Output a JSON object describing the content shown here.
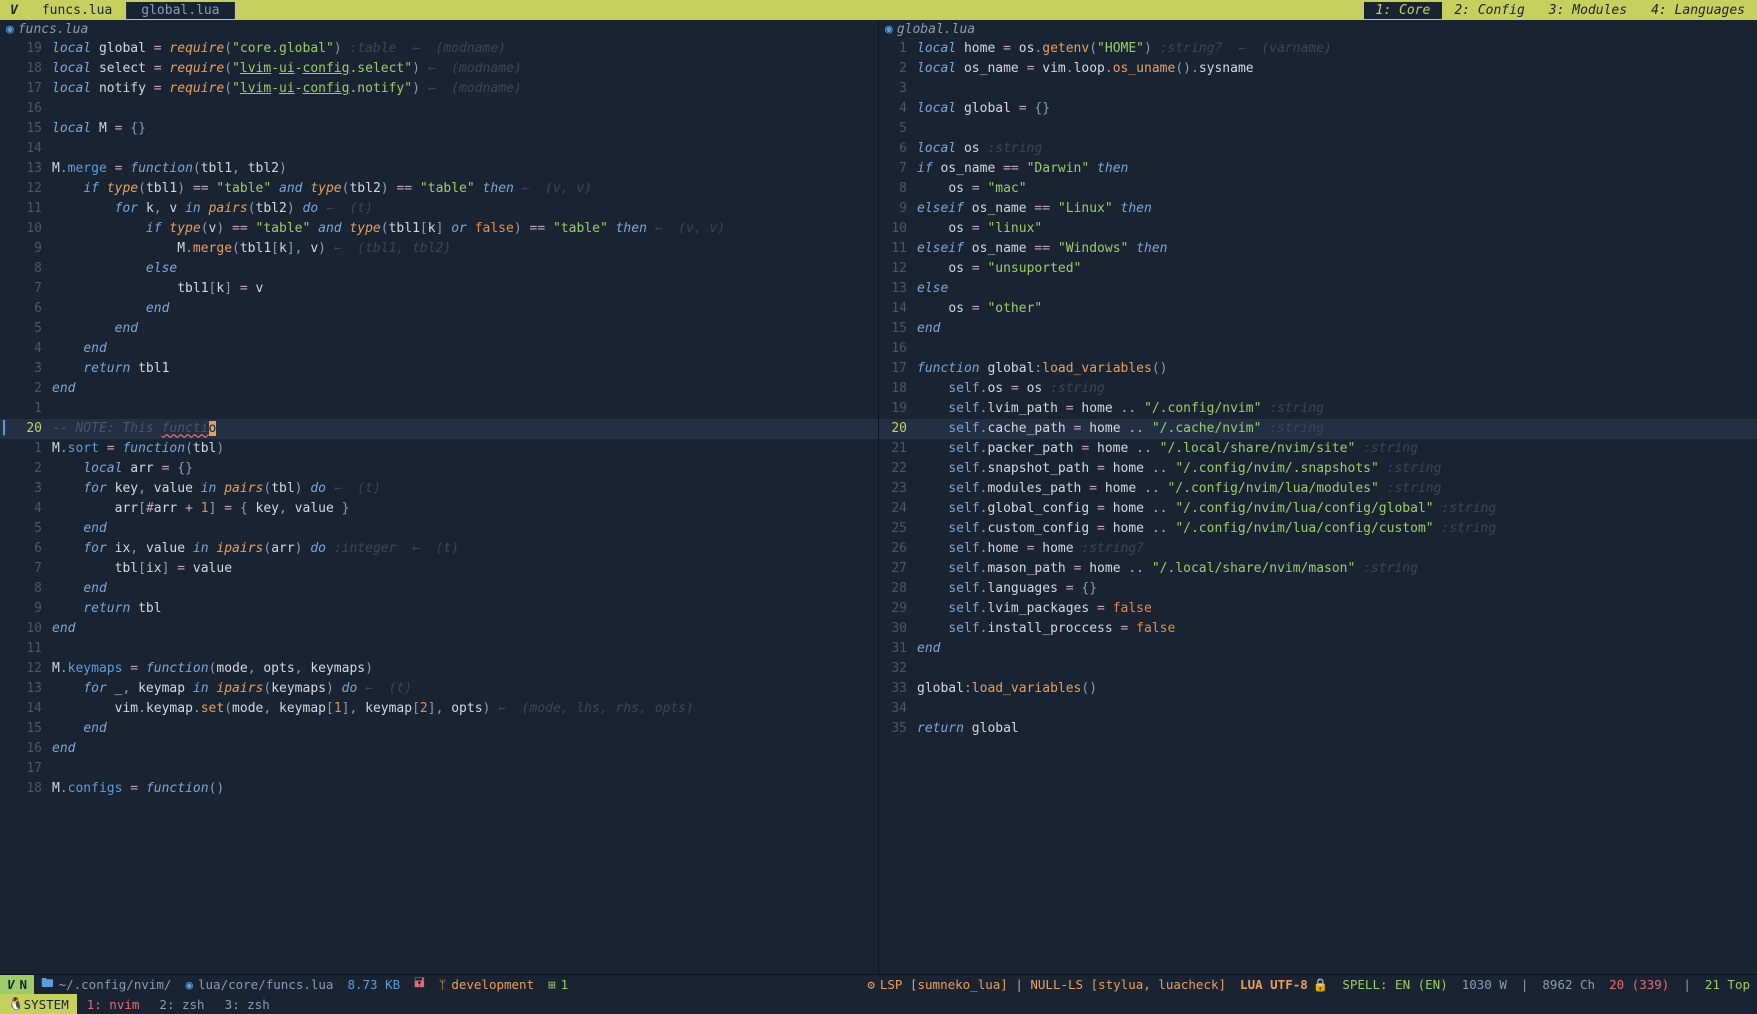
{
  "tabbar": {
    "logo": "V",
    "tabs": [
      {
        "label": "funcs.lua",
        "active": true
      },
      {
        "label": "global.lua",
        "active": false
      }
    ],
    "workspaces": [
      {
        "label": "1: Core",
        "active": true
      },
      {
        "label": "2: Config",
        "active": false
      },
      {
        "label": "3: Modules",
        "active": false
      },
      {
        "label": "4: Languages",
        "active": false
      }
    ]
  },
  "panes": {
    "left": {
      "title": "funcs.lua",
      "lines": [
        {
          "n": "19",
          "m": "",
          "h": "<span class='kw'>local</span> <span class='var'>global</span> <span class='op'>=</span> <span class='fn'>require</span><span class='paren'>(</span><span class='str'>\"core.global\"</span><span class='paren'>)</span> <span class='type'>:table</span>  <span class='hint'>←  (modname)</span>"
        },
        {
          "n": "18",
          "m": "",
          "h": "<span class='kw'>local</span> <span class='var'>select</span> <span class='op'>=</span> <span class='fn'>require</span><span class='paren'>(</span><span class='str'>\"</span><span class='strund'>lvim</span><span class='str'>-</span><span class='strund'>ui</span><span class='str'>-</span><span class='strund'>config</span><span class='str'>.select\"</span><span class='paren'>)</span> <span class='hint'>←  (modname)</span>"
        },
        {
          "n": "17",
          "m": "",
          "h": "<span class='kw'>local</span> <span class='var'>notify</span> <span class='op'>=</span> <span class='fn'>require</span><span class='paren'>(</span><span class='str'>\"</span><span class='strund'>lvim</span><span class='str'>-</span><span class='strund'>ui</span><span class='str'>-</span><span class='strund'>config</span><span class='str'>.notify\"</span><span class='paren'>)</span> <span class='hint'>←  (modname)</span>"
        },
        {
          "n": "16",
          "m": "",
          "h": ""
        },
        {
          "n": "15",
          "m": "",
          "h": "<span class='kw'>local</span> <span class='var'>M</span> <span class='op'>=</span> <span class='paren'>{}</span>"
        },
        {
          "n": "14",
          "m": "",
          "h": ""
        },
        {
          "n": "13",
          "m": "",
          "h": "<span class='var'>M</span>.<span class='field'>merge</span> <span class='op'>=</span> <span class='kw'>function</span><span class='paren'>(</span><span class='var'>tbl1</span>, <span class='var'>tbl2</span><span class='paren'>)</span>"
        },
        {
          "n": "12",
          "m": "",
          "h": "    <span class='kw'>if</span> <span class='fn'>type</span><span class='paren'>(</span><span class='var'>tbl1</span><span class='paren'>)</span> <span class='op'>==</span> <span class='str'>\"table\"</span> <span class='kw'>and</span> <span class='fn'>type</span><span class='paren'>(</span><span class='var'>tbl2</span><span class='paren'>)</span> <span class='op'>==</span> <span class='str'>\"table\"</span> <span class='kw'>then</span> <span class='hint'>←  (v, v)</span>"
        },
        {
          "n": "11",
          "m": "",
          "h": "        <span class='kw'>for</span> <span class='var'>k</span>, <span class='var'>v</span> <span class='kw'>in</span> <span class='fn'>pairs</span><span class='paren'>(</span><span class='var'>tbl2</span><span class='paren'>)</span> <span class='kw'>do</span> <span class='hint'>←  (t)</span>"
        },
        {
          "n": "10",
          "m": "",
          "h": "            <span class='kw'>if</span> <span class='fn'>type</span><span class='paren'>(</span><span class='var'>v</span><span class='paren'>)</span> <span class='op'>==</span> <span class='str'>\"table\"</span> <span class='kw'>and</span> <span class='fn'>type</span><span class='paren'>(</span><span class='var'>tbl1</span><span class='paren'>[</span><span class='var'>k</span><span class='paren'>]</span> <span class='kw'>or</span> <span class='bool'>false</span><span class='paren'>)</span> <span class='op'>==</span> <span class='str'>\"table\"</span> <span class='kw'>then</span> <span class='hint'>←  (v, v)</span>"
        },
        {
          "n": "9",
          "m": "",
          "h": "                <span class='var'>M</span>.<span class='call'>merge</span><span class='paren'>(</span><span class='var'>tbl1</span><span class='paren'>[</span><span class='var'>k</span><span class='paren'>]</span>, <span class='var'>v</span><span class='paren'>)</span> <span class='hint'>←  (tbl1, tbl2)</span>"
        },
        {
          "n": "8",
          "m": "",
          "h": "            <span class='kw'>else</span>"
        },
        {
          "n": "7",
          "m": "",
          "h": "                <span class='var'>tbl1</span><span class='paren'>[</span><span class='var'>k</span><span class='paren'>]</span> <span class='op'>=</span> <span class='var'>v</span>"
        },
        {
          "n": "6",
          "m": "",
          "h": "            <span class='kw'>end</span>"
        },
        {
          "n": "5",
          "m": "",
          "h": "        <span class='kw'>end</span>"
        },
        {
          "n": "4",
          "m": "",
          "h": "    <span class='kw'>end</span>"
        },
        {
          "n": "3",
          "m": "",
          "h": "    <span class='kw'>return</span> <span class='var'>tbl1</span>"
        },
        {
          "n": "2",
          "m": "",
          "h": "<span class='kw'>end</span>"
        },
        {
          "n": "1",
          "m": "",
          "h": ""
        },
        {
          "n": "20",
          "m": "▎",
          "cur": true,
          "h": "<span class='cm'>-- NOTE: This </span><span class='cm' style='text-decoration:underline wavy #e06c75'>functi</span><span class='cursor'>o</span>"
        },
        {
          "n": "1",
          "m": "",
          "h": "<span class='var'>M</span>.<span class='field'>sort</span> <span class='op'>=</span> <span class='kw'>function</span><span class='paren'>(</span><span class='var'>tbl</span><span class='paren'>)</span>"
        },
        {
          "n": "2",
          "m": "",
          "h": "    <span class='kw'>local</span> <span class='var'>arr</span> <span class='op'>=</span> <span class='paren'>{}</span>"
        },
        {
          "n": "3",
          "m": "",
          "h": "    <span class='kw'>for</span> <span class='var'>key</span>, <span class='var'>value</span> <span class='kw'>in</span> <span class='fn'>pairs</span><span class='paren'>(</span><span class='var'>tbl</span><span class='paren'>)</span> <span class='kw'>do</span> <span class='hint'>←  (t)</span>"
        },
        {
          "n": "4",
          "m": "",
          "h": "        <span class='var'>arr</span><span class='paren'>[</span><span class='op'>#</span><span class='var'>arr</span> <span class='op'>+</span> <span class='num'>1</span><span class='paren'>]</span> <span class='op'>=</span> <span class='paren'>{</span> <span class='var'>key</span>, <span class='var'>value</span> <span class='paren'>}</span>"
        },
        {
          "n": "5",
          "m": "",
          "h": "    <span class='kw'>end</span>"
        },
        {
          "n": "6",
          "m": "",
          "h": "    <span class='kw'>for</span> <span class='var'>ix</span>, <span class='var'>value</span> <span class='kw'>in</span> <span class='fn'>ipairs</span><span class='paren'>(</span><span class='var'>arr</span><span class='paren'>)</span> <span class='kw'>do</span> <span class='type'>:integer</span>  <span class='hint'>←  (t)</span>"
        },
        {
          "n": "7",
          "m": "",
          "h": "        <span class='var'>tbl</span><span class='paren'>[</span><span class='var'>ix</span><span class='paren'>]</span> <span class='op'>=</span> <span class='var'>value</span>"
        },
        {
          "n": "8",
          "m": "",
          "h": "    <span class='kw'>end</span>"
        },
        {
          "n": "9",
          "m": "",
          "h": "    <span class='kw'>return</span> <span class='var'>tbl</span>"
        },
        {
          "n": "10",
          "m": "",
          "h": "<span class='kw'>end</span>"
        },
        {
          "n": "11",
          "m": "",
          "h": ""
        },
        {
          "n": "12",
          "m": "",
          "h": "<span class='var'>M</span>.<span class='field'>keymaps</span> <span class='op'>=</span> <span class='kw'>function</span><span class='paren'>(</span><span class='var'>mode</span>, <span class='var'>opts</span>, <span class='var'>keymaps</span><span class='paren'>)</span>"
        },
        {
          "n": "13",
          "m": "",
          "h": "    <span class='kw'>for</span> <span class='var'>_</span>, <span class='var'>keymap</span> <span class='kw'>in</span> <span class='fn'>ipairs</span><span class='paren'>(</span><span class='var'>keymaps</span><span class='paren'>)</span> <span class='kw'>do</span> <span class='hint'>←  (t)</span>"
        },
        {
          "n": "14",
          "m": "",
          "h": "        <span class='var'>vim</span>.<span class='var'>keymap</span>.<span class='call'>set</span><span class='paren'>(</span><span class='var'>mode</span>, <span class='var'>keymap</span><span class='paren'>[</span><span class='num'>1</span><span class='paren'>]</span>, <span class='var'>keymap</span><span class='paren'>[</span><span class='num'>2</span><span class='paren'>]</span>, <span class='var'>opts</span><span class='paren'>)</span> <span class='hint'>←  (mode, lhs, rhs, opts)</span>"
        },
        {
          "n": "15",
          "m": "",
          "h": "    <span class='kw'>end</span>"
        },
        {
          "n": "16",
          "m": "",
          "h": "<span class='kw'>end</span>"
        },
        {
          "n": "17",
          "m": "",
          "h": ""
        },
        {
          "n": "18",
          "m": "",
          "h": "<span class='var'>M</span>.<span class='field'>configs</span> <span class='op'>=</span> <span class='kw'>function</span><span class='paren'>()</span>"
        }
      ]
    },
    "right": {
      "title": "global.lua",
      "lines": [
        {
          "n": "1",
          "h": "<span class='kw'>local</span> <span class='var'>home</span> <span class='op'>=</span> <span class='var'>os</span>.<span class='call'>getenv</span><span class='paren'>(</span><span class='str'>\"HOME\"</span><span class='paren'>)</span> <span class='type'>:string?</span>  <span class='hint'>←  (varname)</span>"
        },
        {
          "n": "2",
          "h": "<span class='kw'>local</span> <span class='var'>os_name</span> <span class='op'>=</span> <span class='var'>vim</span>.<span class='var'>loop</span>.<span class='call'>os_uname</span><span class='paren'>()</span>.<span class='prop'>sysname</span>"
        },
        {
          "n": "3",
          "h": ""
        },
        {
          "n": "4",
          "h": "<span class='kw'>local</span> <span class='var'>global</span> <span class='op'>=</span> <span class='paren'>{}</span>"
        },
        {
          "n": "5",
          "h": ""
        },
        {
          "n": "6",
          "h": "<span class='kw'>local</span> <span class='var'>os</span> <span class='type'>:string</span>"
        },
        {
          "n": "7",
          "h": "<span class='kw'>if</span> <span class='var'>os_name</span> <span class='op'>==</span> <span class='str'>\"Darwin\"</span> <span class='kw'>then</span>"
        },
        {
          "n": "8",
          "h": "    <span class='var'>os</span> <span class='op'>=</span> <span class='str'>\"mac\"</span>"
        },
        {
          "n": "9",
          "h": "<span class='kw'>elseif</span> <span class='var'>os_name</span> <span class='op'>==</span> <span class='str'>\"Linux\"</span> <span class='kw'>then</span>"
        },
        {
          "n": "10",
          "h": "    <span class='var'>os</span> <span class='op'>=</span> <span class='str'>\"linux\"</span>"
        },
        {
          "n": "11",
          "h": "<span class='kw'>elseif</span> <span class='var'>os_name</span> <span class='op'>==</span> <span class='str'>\"Windows\"</span> <span class='kw'>then</span>"
        },
        {
          "n": "12",
          "h": "    <span class='var'>os</span> <span class='op'>=</span> <span class='str'>\"unsuported\"</span>"
        },
        {
          "n": "13",
          "h": "<span class='kw'>else</span>"
        },
        {
          "n": "14",
          "h": "    <span class='var'>os</span> <span class='op'>=</span> <span class='str'>\"other\"</span>"
        },
        {
          "n": "15",
          "h": "<span class='kw'>end</span>"
        },
        {
          "n": "16",
          "h": ""
        },
        {
          "n": "17",
          "h": "<span class='kw'>function</span> <span class='var'>global</span>:<span class='call'>load_variables</span><span class='paren'>()</span>"
        },
        {
          "n": "18",
          "h": "    <span class='self'>self</span>.<span class='prop'>os</span> <span class='op'>=</span> <span class='var'>os</span> <span class='type'>:string</span>"
        },
        {
          "n": "19",
          "h": "    <span class='self'>self</span>.<span class='prop'>lvim_path</span> <span class='op'>=</span> <span class='var'>home</span> <span class='op'>..</span> <span class='str'>\"/.config/nvim\"</span> <span class='type'>:string</span>"
        },
        {
          "n": "20",
          "cur": true,
          "h": "    <span class='self'>self</span>.<span class='prop'>cache_path</span> <span class='op'>=</span> <span class='var'>home</span> <span class='op'>..</span> <span class='str'>\"/.cache/nvim\"</span> <span class='type'>:string</span>"
        },
        {
          "n": "21",
          "h": "    <span class='self'>self</span>.<span class='prop'>packer_path</span> <span class='op'>=</span> <span class='var'>home</span> <span class='op'>..</span> <span class='str'>\"/.local/share/nvim/site\"</span> <span class='type'>:string</span>"
        },
        {
          "n": "22",
          "h": "    <span class='self'>self</span>.<span class='prop'>snapshot_path</span> <span class='op'>=</span> <span class='var'>home</span> <span class='op'>..</span> <span class='str'>\"/.config/nvim/.snapshots\"</span> <span class='type'>:string</span>"
        },
        {
          "n": "23",
          "h": "    <span class='self'>self</span>.<span class='prop'>modules_path</span> <span class='op'>=</span> <span class='var'>home</span> <span class='op'>..</span> <span class='str'>\"/.config/nvim/lua/modules\"</span> <span class='type'>:string</span>"
        },
        {
          "n": "24",
          "h": "    <span class='self'>self</span>.<span class='prop'>global_config</span> <span class='op'>=</span> <span class='var'>home</span> <span class='op'>..</span> <span class='str'>\"/.config/nvim/lua/config/global\"</span> <span class='type'>:string</span>"
        },
        {
          "n": "25",
          "h": "    <span class='self'>self</span>.<span class='prop'>custom_config</span> <span class='op'>=</span> <span class='var'>home</span> <span class='op'>..</span> <span class='str'>\"/.config/nvim/lua/config/custom\"</span> <span class='type'>:string</span>"
        },
        {
          "n": "26",
          "h": "    <span class='self'>self</span>.<span class='prop'>home</span> <span class='op'>=</span> <span class='var'>home</span> <span class='type'>:string?</span>"
        },
        {
          "n": "27",
          "h": "    <span class='self'>self</span>.<span class='prop'>mason_path</span> <span class='op'>=</span> <span class='var'>home</span> <span class='op'>..</span> <span class='str'>\"/.local/share/nvim/mason\"</span> <span class='type'>:string</span>"
        },
        {
          "n": "28",
          "h": "    <span class='self'>self</span>.<span class='prop'>languages</span> <span class='op'>=</span> <span class='paren'>{}</span>"
        },
        {
          "n": "29",
          "h": "    <span class='self'>self</span>.<span class='prop'>lvim_packages</span> <span class='op'>=</span> <span class='bool'>false</span>"
        },
        {
          "n": "30",
          "h": "    <span class='self'>self</span>.<span class='prop'>install_proccess</span> <span class='op'>=</span> <span class='bool'>false</span>"
        },
        {
          "n": "31",
          "h": "<span class='kw'>end</span>"
        },
        {
          "n": "32",
          "h": ""
        },
        {
          "n": "33",
          "h": "<span class='var'>global</span>:<span class='call'>load_variables</span><span class='paren'>()</span>"
        },
        {
          "n": "34",
          "h": ""
        },
        {
          "n": "35",
          "h": "<span class='kw'>return</span> <span class='var'>global</span>"
        }
      ]
    }
  },
  "statusbar": {
    "mode_logo": "V",
    "mode": "N",
    "cwd": "~/.config/nvim/",
    "file": "lua/core/funcs.lua",
    "size": "8.73 KB",
    "branch": "development",
    "diff": "1",
    "lsp": "LSP [sumneko_lua] | NULL-LS [stylua, luacheck]",
    "enc": "LUA UTF-8",
    "spell": "SPELL: EN (EN)",
    "words": "1030 W",
    "chars": "8962 Ch",
    "pos": "20 (339)",
    "scroll": "21 Top"
  },
  "tmux": {
    "session": "SYSTEM",
    "windows": [
      {
        "label": "1: nvim",
        "active": true
      },
      {
        "label": "2: zsh",
        "active": false
      },
      {
        "label": "3: zsh",
        "active": false
      }
    ]
  }
}
